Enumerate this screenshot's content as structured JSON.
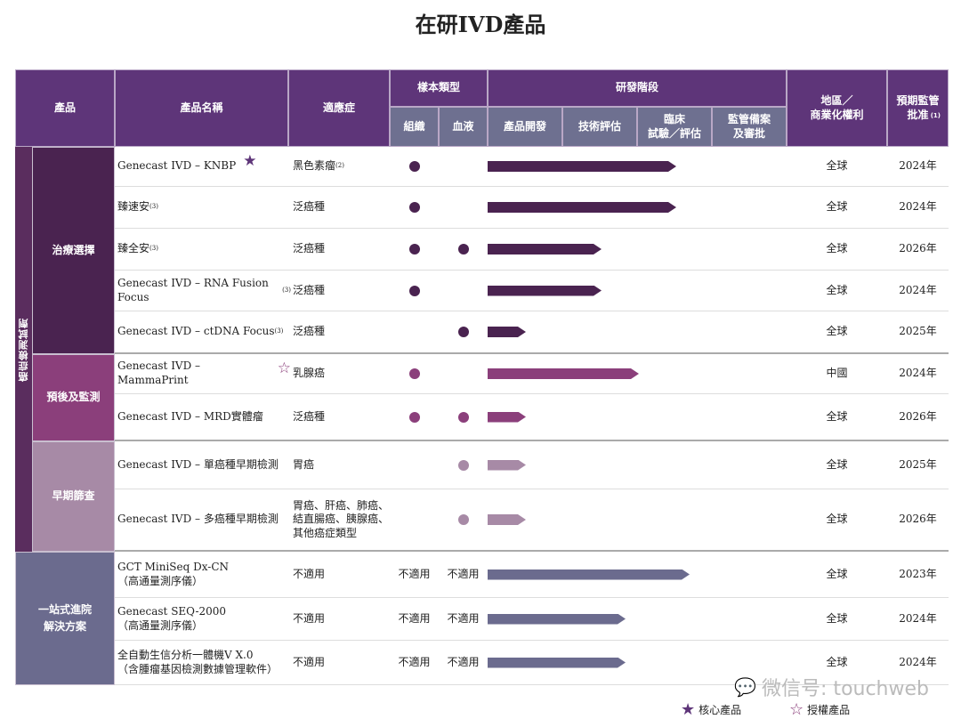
{
  "title": "在研IVD產品",
  "headers": {
    "product": "產品",
    "name": "產品名稱",
    "indication": "適應症",
    "sample_type": "樣本類型",
    "tissue": "組織",
    "blood": "血液",
    "rd_stage": "研發階段",
    "stages": [
      "產品開發",
      "技術評估",
      "臨床\n試驗／評估",
      "監管備案\n及審批"
    ],
    "region": "地區／\n商業化權利",
    "approval": "預期監管\n批准",
    "approval_note": "(1)"
  },
  "vertical_label": "癌症檢測試劑",
  "categories": [
    {
      "label": "治療選擇",
      "color": "#4a2350"
    },
    {
      "label": "預後及監測",
      "color": "#8b3f7b"
    },
    {
      "label": "早期篩查",
      "color": "#a78aa6"
    },
    {
      "label": "一站式進院\n解決方案",
      "color": "#6b6b8e"
    }
  ],
  "rows": [
    {
      "name": "Genecast IVD – KNBP",
      "star": "core",
      "indication": "黑色素瘤",
      "ind_note": "(2)",
      "tissue": true,
      "blood": false,
      "progress_stages": 2.52,
      "region": "全球",
      "year": "2024年",
      "cat": 0
    },
    {
      "name": "臻速安",
      "note": "(3)",
      "indication": "泛癌種",
      "tissue": true,
      "blood": false,
      "progress_stages": 2.52,
      "region": "全球",
      "year": "2024年",
      "cat": 0
    },
    {
      "name": "臻全安",
      "note": "(3)",
      "indication": "泛癌種",
      "tissue": true,
      "blood": true,
      "progress_stages": 1.52,
      "region": "全球",
      "year": "2026年",
      "cat": 0
    },
    {
      "name": "Genecast IVD – RNA Fusion Focus",
      "note": "(3)",
      "indication": "泛癌種",
      "tissue": true,
      "blood": false,
      "progress_stages": 1.52,
      "region": "全球",
      "year": "2024年",
      "cat": 0
    },
    {
      "name": "Genecast IVD – ctDNA Focus",
      "note": "(3)",
      "indication": "泛癌種",
      "tissue": false,
      "blood": true,
      "progress_stages": 0.51,
      "region": "全球",
      "year": "2025年",
      "cat": 0
    },
    {
      "name": "Genecast IVD – MammaPrint",
      "star": "licensed",
      "indication": "乳腺癌",
      "tissue": true,
      "blood": false,
      "progress_stages": 2.02,
      "region": "中國",
      "year": "2024年",
      "cat": 1
    },
    {
      "name": "Genecast IVD – MRD實體瘤",
      "indication": "泛癌種",
      "tissue": true,
      "blood": true,
      "progress_stages": 0.51,
      "region": "全球",
      "year": "2026年",
      "cat": 1
    },
    {
      "name": "Genecast IVD – 單癌種早期檢測",
      "indication": "胃癌",
      "tissue": false,
      "blood": true,
      "progress_stages": 0.51,
      "region": "全球",
      "year": "2025年",
      "cat": 2
    },
    {
      "name": "Genecast IVD – 多癌種早期檢測",
      "indication": "胃癌、肝癌、肺癌、\n結直腸癌、胰腺癌、\n其他癌症類型",
      "tissue": false,
      "blood": true,
      "progress_stages": 0.51,
      "region": "全球",
      "year": "2026年",
      "cat": 2
    },
    {
      "name": "GCT MiniSeq Dx-CN\n（高通量測序儀）",
      "indication": "不適用",
      "tissue_text": "不適用",
      "blood_text": "不適用",
      "progress_stages": 2.7,
      "region": "全球",
      "year": "2023年",
      "cat": 3
    },
    {
      "name": "Genecast SEQ-2000\n（高通量測序儀）",
      "indication": "不適用",
      "tissue_text": "不適用",
      "blood_text": "不適用",
      "progress_stages": 1.85,
      "region": "全球",
      "year": "2024年",
      "cat": 3
    },
    {
      "name": "全自動生信分析一體機V X.0\n（含腫瘤基因檢測數據管理軟件）",
      "indication": "不適用",
      "tissue_text": "不適用",
      "blood_text": "不適用",
      "progress_stages": 1.85,
      "region": "全球",
      "year": "2024年",
      "cat": 3
    }
  ],
  "legend": {
    "core": "核心產品",
    "licensed": "授權產品"
  },
  "watermark": "微信号: touchweb",
  "colors": {
    "header": "#5e3579",
    "subheader": "#6e7090",
    "star": "#5e3579"
  }
}
